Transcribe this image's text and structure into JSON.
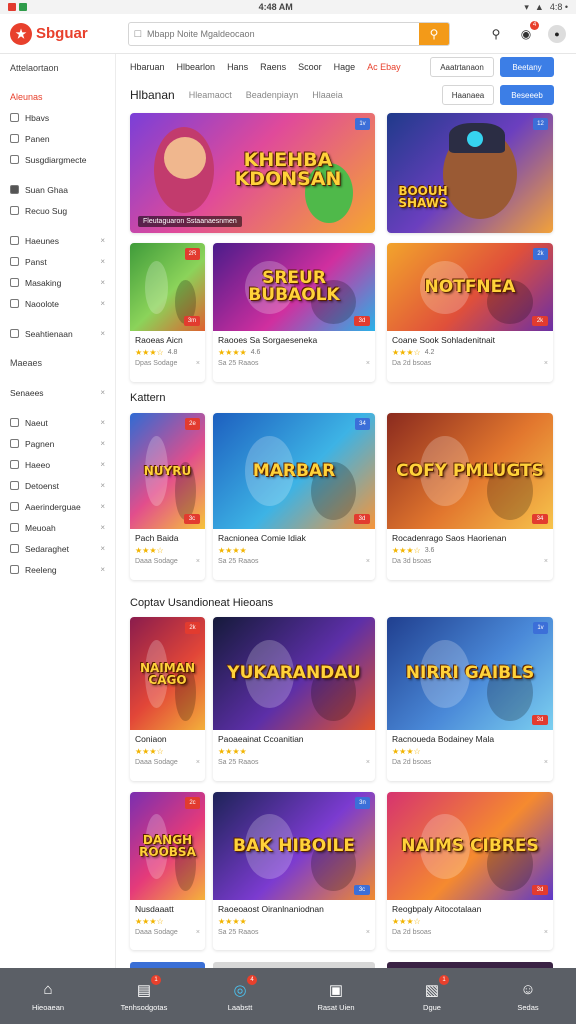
{
  "status_bar": {
    "time": "4:48 AM",
    "right_text": "4:8 •"
  },
  "header": {
    "logo_text": "Sbguar",
    "search_placeholder": "Mbapp Noite Mgaldeocaon",
    "search_icon": "search-icon",
    "icons": [
      "help-icon",
      "notification-icon",
      "profile-icon"
    ],
    "notification_count": "4"
  },
  "sidebar": {
    "section1": "Attelaortaon",
    "section2": "Aleunas",
    "items_a": [
      {
        "label": "Hbavs",
        "icon": "grid-icon"
      },
      {
        "label": "Panen",
        "icon": "monitor-icon"
      },
      {
        "label": "Susgdiargmecte",
        "icon": "chart-icon"
      }
    ],
    "items_b": [
      {
        "label": "Suan Ghaa",
        "icon": "bookmark-icon",
        "active": true
      },
      {
        "label": "Recuo Sug",
        "icon": "image-icon"
      }
    ],
    "items_c": [
      {
        "label": "Haeunes",
        "icon": "shop-icon"
      },
      {
        "label": "Panst",
        "icon": "box-icon"
      },
      {
        "label": "Masaking",
        "icon": "list-icon"
      },
      {
        "label": "Naoolote",
        "icon": "card-icon"
      }
    ],
    "items_d": [
      {
        "label": "Seahtienaan",
        "icon": "monitor-icon"
      }
    ],
    "section3": "Maeaes",
    "section4": "Senaees",
    "items_e": [
      {
        "label": "Naeut",
        "icon": "clock-icon"
      },
      {
        "label": "Pagnen",
        "icon": "settings-icon"
      },
      {
        "label": "Haeeo",
        "icon": "globe-icon"
      },
      {
        "label": "Detoenst",
        "icon": "circle-icon"
      },
      {
        "label": "Aaerinderguae",
        "icon": "star-icon"
      },
      {
        "label": "Meuoah",
        "icon": "layers-icon"
      },
      {
        "label": "Sedaraghet",
        "icon": "tag-icon"
      },
      {
        "label": "Reeleng",
        "icon": "chart-icon"
      }
    ]
  },
  "category_tabs": {
    "tabs": [
      "Hbaruan",
      "Hlbearlon",
      "Hans",
      "Raens",
      "Scoor",
      "Hage"
    ],
    "special": "Ac Ebay",
    "btn_secondary": "Aaatrtanaon",
    "btn_primary": "Beetany"
  },
  "row_head": {
    "title": "Hlbanan",
    "tabs": [
      "Hleamaoct",
      "Beadenpiayn",
      "Hlaaeia"
    ],
    "btn_secondary": "Haanaea",
    "btn_primary": "Beseeeb"
  },
  "hero": [
    {
      "title_text": "KHEHBA KDONSAN",
      "caption": "Fleutaguaron Sstaanaesnmen",
      "tag": "1v"
    },
    {
      "title_text": "BOOUH SHAWS",
      "tag": "12"
    }
  ],
  "section_kattern": "Kattern",
  "section_coptav": "Coptav Usandioneat Hieoans",
  "cards_row1": [
    {
      "thumb_text": "",
      "tag": "2R",
      "tagb": "3m",
      "title": "Raoeas Aicn",
      "rating": "★★★☆",
      "score": "4.8",
      "meta": "Dpas Sodage"
    },
    {
      "thumb_text": "SREUR BUBAOLK",
      "tag": "",
      "tagb": "3d",
      "title": "Raooes Sa Sorgaeseneka",
      "rating": "★★★★",
      "score": "4.6",
      "meta": "Sa 25 Raaos"
    },
    {
      "thumb_text": "NOTFNEA",
      "tag": "2k",
      "tagb": "2k",
      "title": "Coane Sook Sohladenitnait",
      "rating": "★★★☆",
      "score": "4.2",
      "meta": "Da 2d bsoas"
    }
  ],
  "cards_row2": [
    {
      "thumb_text": "NUYRU",
      "tag": "2e",
      "tagb": "3c",
      "title": "Pach Baida",
      "rating": "★★★☆",
      "score": "",
      "meta": "Daaa Sodage"
    },
    {
      "thumb_text": "MARBAR",
      "tag": "34",
      "tagb": "3d",
      "title": "Racnionea Comie Idiak",
      "rating": "★★★★",
      "score": "",
      "meta": "Sa 25 Raaos"
    },
    {
      "thumb_text": "COFY PMLUGTS",
      "tag": "",
      "tagb": "34",
      "title": "Rocadenrago Saos Haorienan",
      "rating": "★★★☆",
      "score": "3.6",
      "meta": "Da 3d bsoas"
    }
  ],
  "cards_row3": [
    {
      "thumb_text": "NAIMAN CAGO",
      "tag": "2k",
      "tagb": "",
      "title": "Coniaon",
      "rating": "★★★☆",
      "score": "",
      "meta": "Daaa Sodage"
    },
    {
      "thumb_text": "YUKARANDAU",
      "tag": "",
      "tagb": "",
      "title": "Paoaeainat Ccoanitian",
      "rating": "★★★★",
      "score": "",
      "meta": "Sa 25 Raaos"
    },
    {
      "thumb_text": "NIRRI GAIBLS",
      "tag": "1v",
      "tagb": "3d",
      "title": "Racnoueda Bodainey Mala",
      "rating": "★★★☆",
      "score": "",
      "meta": "Da 2d bsoas"
    }
  ],
  "cards_row4": [
    {
      "thumb_text": "DANGH ROOBSA",
      "tag": "2c",
      "tagb": "",
      "title": "Nusdaaatt",
      "rating": "★★★☆",
      "score": "",
      "meta": "Daaa Sodage"
    },
    {
      "thumb_text": "BAK HIBOILE",
      "tag": "3n",
      "tagb": "3c",
      "title": "Raoeoaost Oiranlnaniodnan",
      "rating": "★★★★",
      "score": "",
      "meta": "Sa 25 Raaos"
    },
    {
      "thumb_text": "NAIMS CIBRES",
      "tag": "",
      "tagb": "3d",
      "title": "Reogbpaly Aitocotalaan",
      "rating": "★★★☆",
      "score": "",
      "meta": "Da 2d bsoas"
    }
  ],
  "bottom_nav": [
    {
      "label": "Hieoaean",
      "icon": "home-icon",
      "badge": ""
    },
    {
      "label": "Tenhsodgotas",
      "icon": "document-icon",
      "badge": "1"
    },
    {
      "label": "Laabstt",
      "icon": "chat-icon",
      "badge": "4"
    },
    {
      "label": "Rasat Uien",
      "icon": "square-icon",
      "badge": ""
    },
    {
      "label": "Dgue",
      "icon": "file-icon",
      "badge": "1"
    },
    {
      "label": "Sedas",
      "icon": "user-icon",
      "badge": ""
    }
  ],
  "colors": {
    "brand": "#e8402c",
    "accent_blue": "#3c7ee6",
    "search_orange": "#f39a18",
    "bottom_nav": "#5b5f66"
  }
}
